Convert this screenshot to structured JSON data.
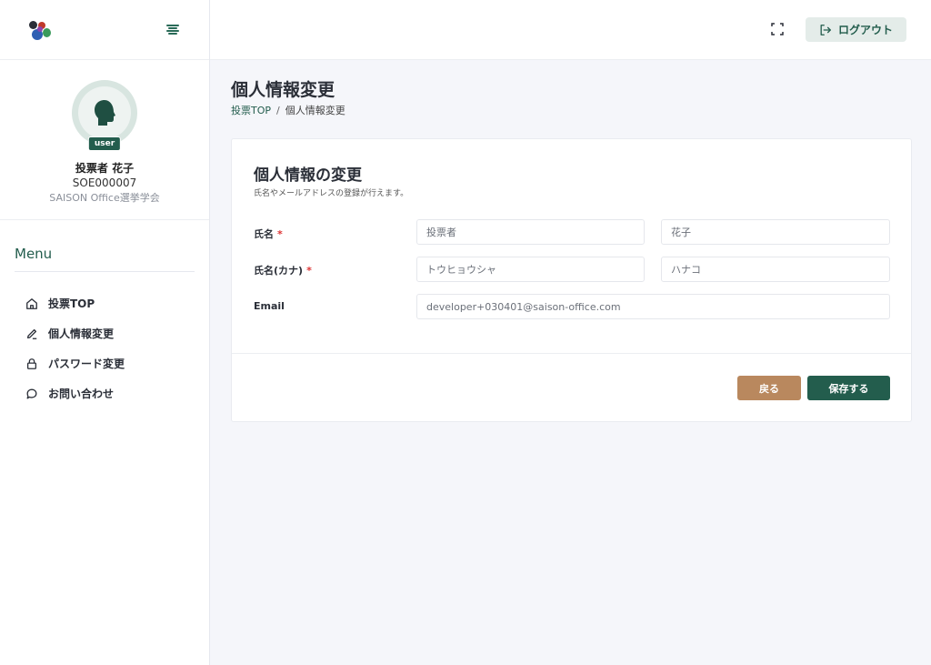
{
  "sidebar": {
    "profile": {
      "badge": "user",
      "name": "投票者 花子",
      "id": "SOE000007",
      "org": "SAISON Office選挙学会"
    },
    "menu_title": "Menu",
    "items": [
      {
        "label": "投票TOP",
        "icon": "home-icon"
      },
      {
        "label": "個人情報変更",
        "icon": "pencil-icon"
      },
      {
        "label": "パスワード変更",
        "icon": "lock-icon"
      },
      {
        "label": "お問い合わせ",
        "icon": "chat-icon"
      }
    ]
  },
  "header": {
    "logout_label": "ログアウト"
  },
  "page": {
    "title": "個人情報変更",
    "breadcrumb": {
      "home": "投票TOP",
      "separator": "/",
      "current": "個人情報変更"
    }
  },
  "form": {
    "title": "個人情報の変更",
    "subtitle": "氏名やメールアドレスの登録が行えます。",
    "name_label": "氏名",
    "kana_label": "氏名(カナ)",
    "email_label": "Email",
    "required_mark": "*",
    "last_name": "投票者",
    "first_name": "花子",
    "last_name_kana": "トウヒョウシャ",
    "first_name_kana": "ハナコ",
    "email": "developer+030401@saison-office.com",
    "back_label": "戻る",
    "save_label": "保存する"
  },
  "colors": {
    "primary": "#235d4d",
    "back_button": "#b9885e",
    "background": "#f5f6fa"
  }
}
